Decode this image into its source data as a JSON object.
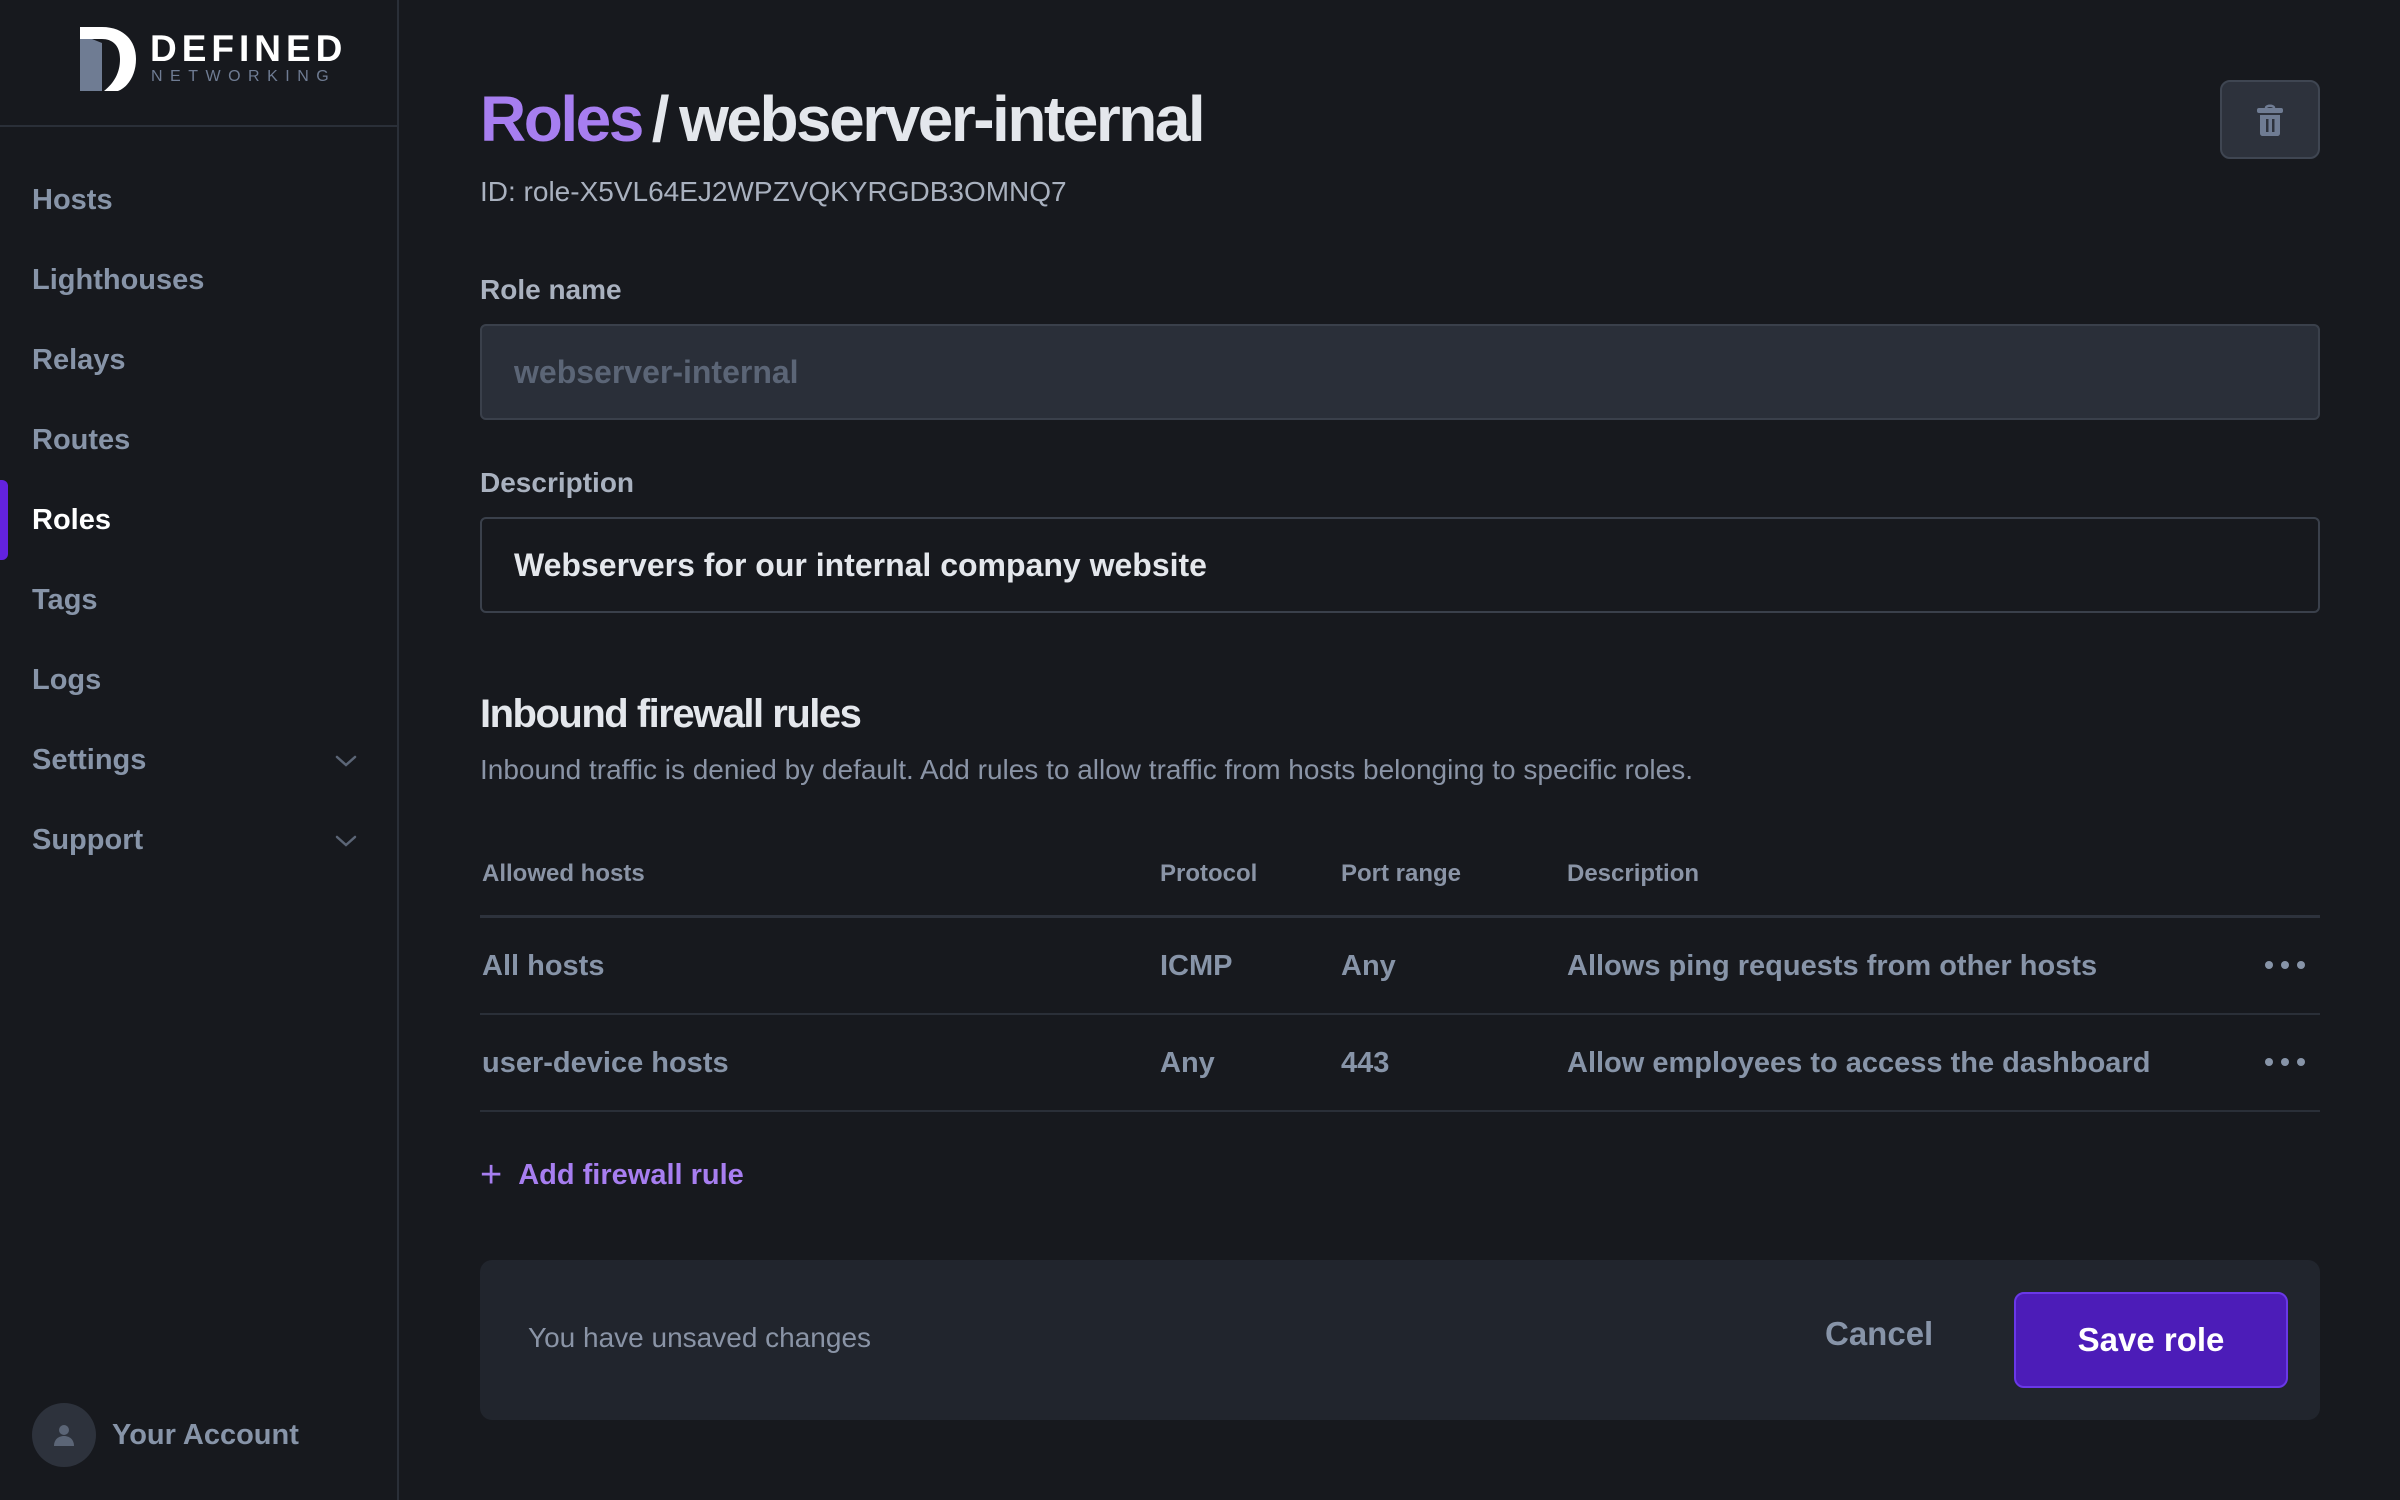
{
  "brand": {
    "name": "DEFINED",
    "tagline": "NETWORKING"
  },
  "sidebar": {
    "items": [
      {
        "label": "Hosts",
        "active": false
      },
      {
        "label": "Lighthouses",
        "active": false
      },
      {
        "label": "Relays",
        "active": false
      },
      {
        "label": "Routes",
        "active": false
      },
      {
        "label": "Roles",
        "active": true
      },
      {
        "label": "Tags",
        "active": false
      },
      {
        "label": "Logs",
        "active": false
      },
      {
        "label": "Settings",
        "active": false,
        "expandable": true
      },
      {
        "label": "Support",
        "active": false,
        "expandable": true
      }
    ],
    "account_label": "Your Account"
  },
  "header": {
    "breadcrumb_parent": "Roles",
    "separator": "/",
    "title": "webserver-internal",
    "role_id": "ID: role-X5VL64EJ2WPZVQKYRGDB3OMNQ7",
    "delete_icon": "trash-icon"
  },
  "form": {
    "role_name_label": "Role name",
    "role_name_value": "webserver-internal",
    "description_label": "Description",
    "description_value": "Webservers for our internal company website"
  },
  "firewall": {
    "title": "Inbound firewall rules",
    "description": "Inbound traffic is denied by default. Add rules to allow traffic from hosts belonging to specific roles.",
    "columns": [
      "Allowed hosts",
      "Protocol",
      "Port range",
      "Description"
    ],
    "rows": [
      {
        "hosts": "All hosts",
        "protocol": "ICMP",
        "port_range": "Any",
        "description": "Allows ping requests from other hosts"
      },
      {
        "hosts": "user-device hosts",
        "protocol": "Any",
        "port_range": "443",
        "description": "Allow employees to access the dashboard"
      }
    ],
    "add_rule_label": "Add firewall rule",
    "add_rule_icon": "+"
  },
  "savebar": {
    "message": "You have unsaved changes",
    "cancel_label": "Cancel",
    "save_label": "Save role"
  },
  "colors": {
    "accent": "#a77ef0",
    "primary_button": "#4c1cb8",
    "active_indicator": "#6322e0",
    "background": "#17191e"
  }
}
